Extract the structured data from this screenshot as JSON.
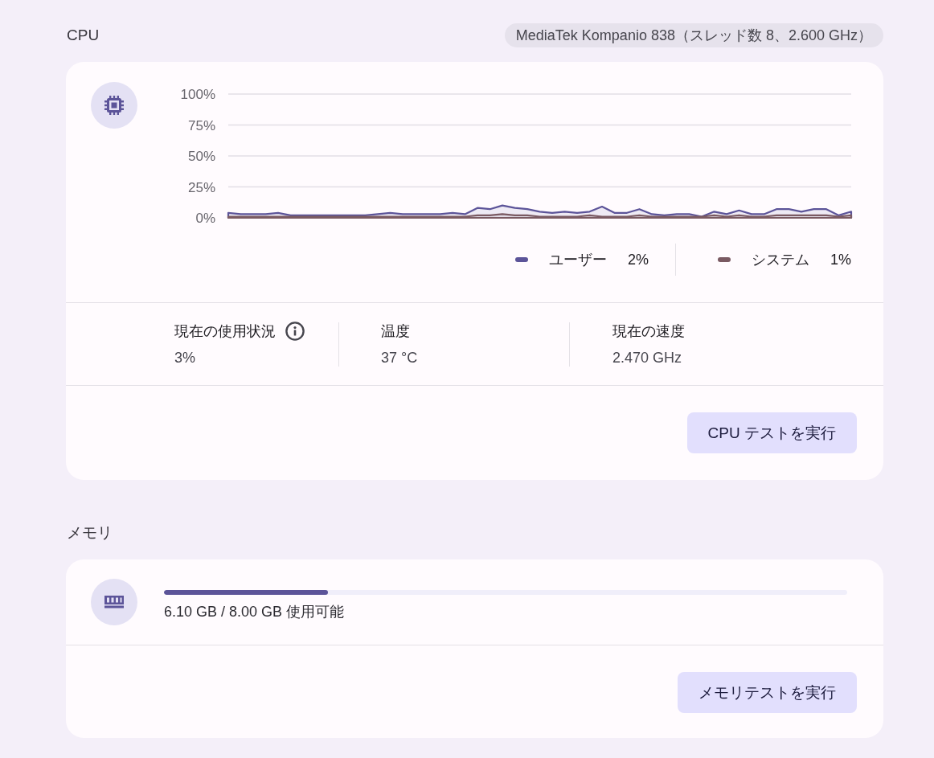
{
  "cpu": {
    "title": "CPU",
    "processor": "MediaTek Kompanio 838（スレッド数 8、2.600 GHz）",
    "chart_data": {
      "type": "area",
      "grid": true,
      "ylim": [
        0,
        100
      ],
      "yticks": [
        {
          "value": 0,
          "label": "0%"
        },
        {
          "value": 25,
          "label": "25%"
        },
        {
          "value": 50,
          "label": "50%"
        },
        {
          "value": 75,
          "label": "75%"
        },
        {
          "value": 100,
          "label": "100%"
        }
      ],
      "series": [
        {
          "name": "ユーザー",
          "color": "#5c5499",
          "values": [
            4,
            3,
            3,
            3,
            4,
            2,
            2,
            2,
            2,
            2,
            2,
            2,
            3,
            4,
            3,
            3,
            3,
            3,
            4,
            3,
            8,
            7,
            10,
            8,
            7,
            5,
            4,
            5,
            4,
            5,
            9,
            4,
            4,
            7,
            3,
            2,
            3,
            3,
            1,
            5,
            3,
            6,
            3,
            3,
            7,
            7,
            5,
            7,
            7,
            2,
            5
          ]
        },
        {
          "name": "システム",
          "color": "#7a5a62",
          "values": [
            1,
            1,
            1,
            1,
            1,
            1,
            1,
            1,
            1,
            1,
            1,
            1,
            1,
            1,
            1,
            1,
            1,
            1,
            1,
            1,
            2,
            2,
            3,
            2,
            2,
            1,
            1,
            1,
            1,
            2,
            1,
            1,
            1,
            2,
            1,
            1,
            1,
            1,
            1,
            2,
            1,
            2,
            1,
            1,
            2,
            2,
            2,
            2,
            2,
            1,
            2
          ]
        }
      ]
    },
    "legend_readings": [
      "2%",
      "1%"
    ],
    "stats": [
      {
        "label": "現在の使用状況",
        "value": "3%",
        "info": true
      },
      {
        "label": "温度",
        "value": "37 °C",
        "info": false
      },
      {
        "label": "現在の速度",
        "value": "2.470 GHz",
        "info": false
      }
    ],
    "button": "CPU テストを実行"
  },
  "memory": {
    "title": "メモリ",
    "level": 0.24,
    "reading": "6.10 GB / 8.00 GB 使用可能",
    "button": "メモリテストを実行"
  }
}
